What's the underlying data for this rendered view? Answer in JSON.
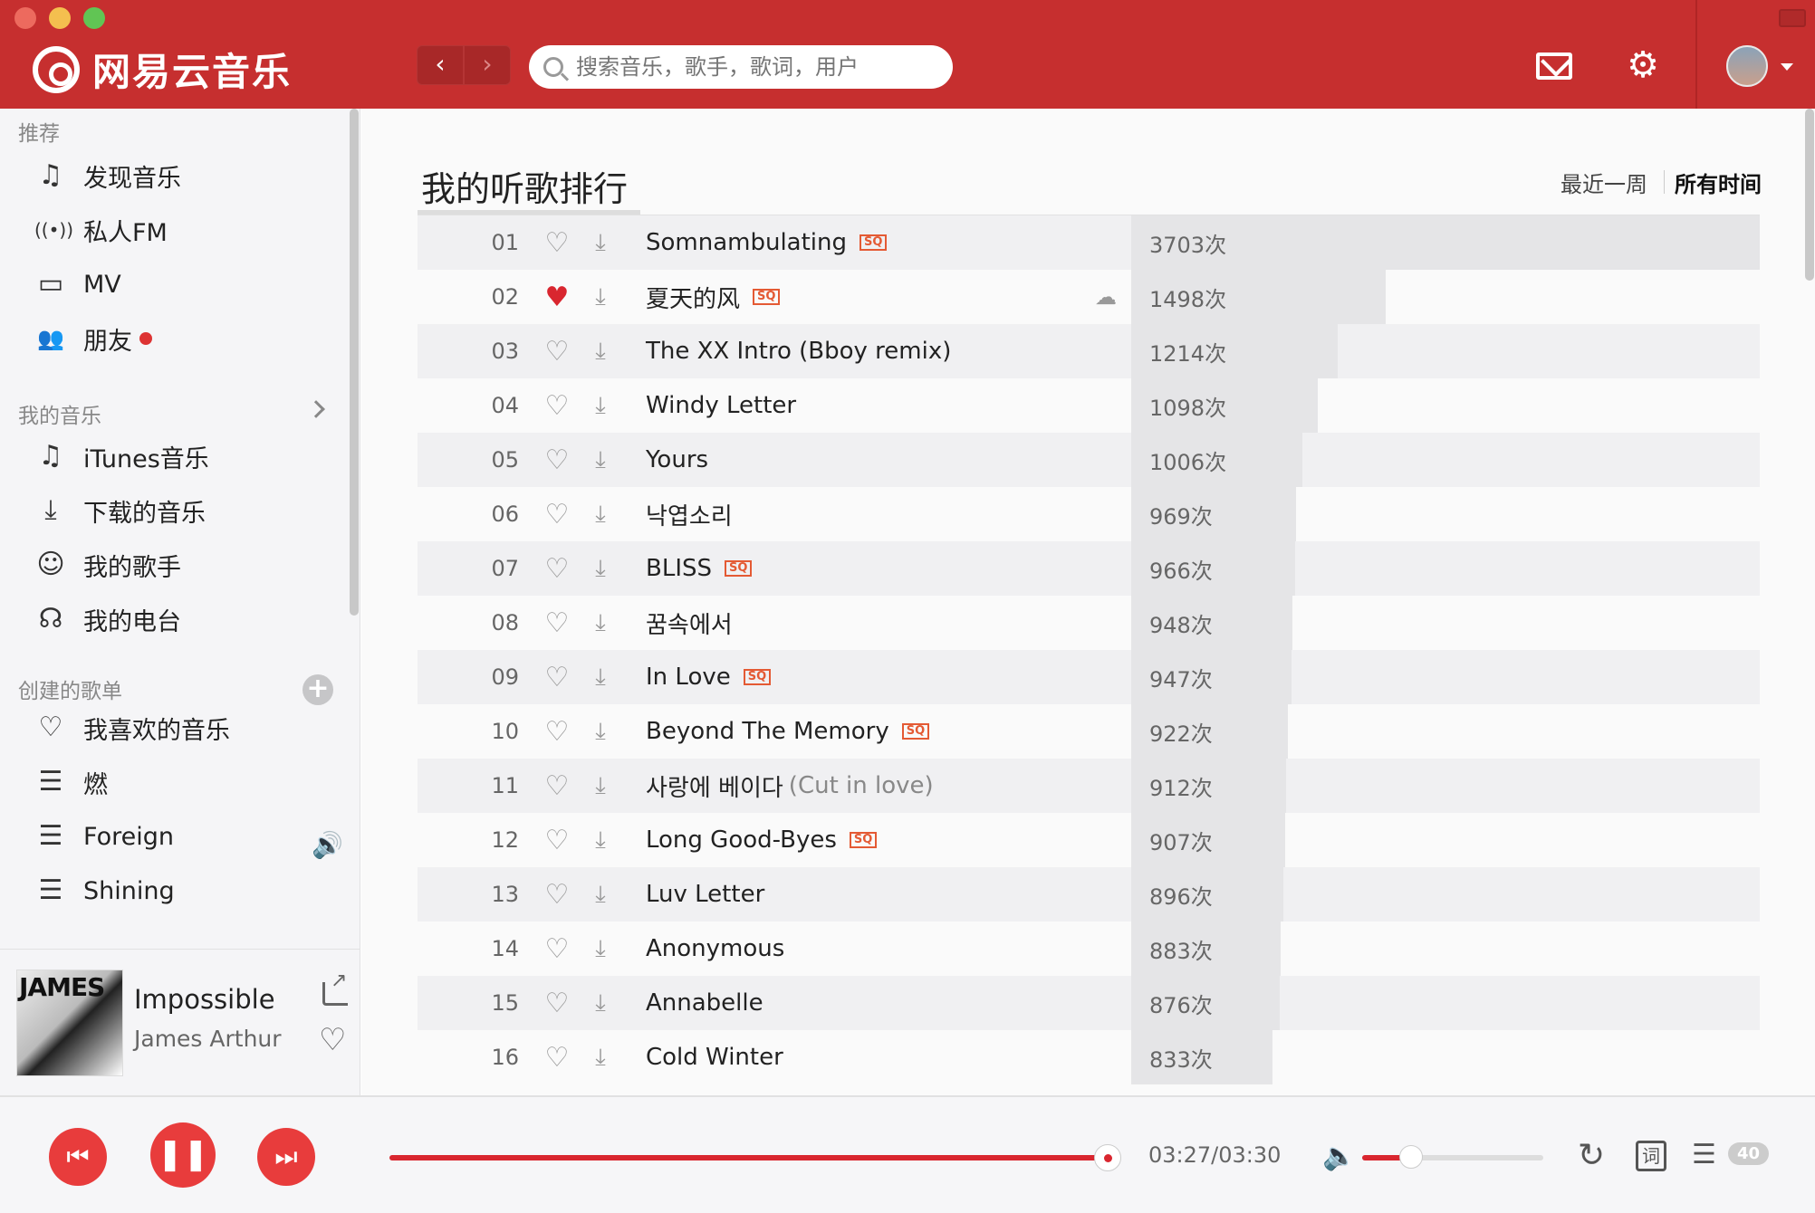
{
  "app": {
    "logo_text": "网易云音乐"
  },
  "header": {
    "back": "‹",
    "forward": "›",
    "search_placeholder": "搜索音乐，歌手，歌词，用户"
  },
  "sidebar": {
    "sec_recommend": "推荐",
    "recommend": [
      {
        "icon": "music-note-icon",
        "glyph": "♫",
        "label": "发现音乐"
      },
      {
        "icon": "radio-icon",
        "glyph": "((•))",
        "label": "私人FM"
      },
      {
        "icon": "tv-icon",
        "glyph": "▭",
        "label": "MV"
      },
      {
        "icon": "friends-icon",
        "glyph": "👥",
        "label": "朋友"
      }
    ],
    "sec_my_music": "我的音乐",
    "my_music": [
      {
        "icon": "itunes-icon",
        "glyph": "♫",
        "label": "iTunes音乐"
      },
      {
        "icon": "download-icon",
        "glyph": "⤓",
        "label": "下载的音乐"
      },
      {
        "icon": "person-icon",
        "glyph": "☺",
        "label": "我的歌手"
      },
      {
        "icon": "podcast-icon",
        "glyph": "☊",
        "label": "我的电台"
      }
    ],
    "sec_created": "创建的歌单",
    "created": [
      {
        "icon": "heart-icon",
        "glyph": "♡",
        "label": "我喜欢的音乐"
      },
      {
        "icon": "playlist-icon",
        "glyph": "☰",
        "label": "燃"
      },
      {
        "icon": "playlist-icon",
        "glyph": "☰",
        "label": "Foreign"
      },
      {
        "icon": "playlist-icon",
        "glyph": "☰",
        "label": "Shining"
      }
    ],
    "now_playing": {
      "cover_text": "JAMES",
      "title": "Impossible",
      "artist": "James Arthur"
    }
  },
  "main": {
    "title": "我的听歌排行",
    "filter_recent": "最近一周",
    "filter_all": "所有时间",
    "songs": [
      {
        "rank": "01",
        "name": "Somnambulating",
        "sub": "",
        "sq": true,
        "liked": false,
        "cloud": false,
        "plays": 3703,
        "count": "3703次"
      },
      {
        "rank": "02",
        "name": "夏天的风",
        "sub": "",
        "sq": true,
        "liked": true,
        "cloud": true,
        "plays": 1498,
        "count": "1498次"
      },
      {
        "rank": "03",
        "name": "The XX Intro (Bboy remix)",
        "sub": "",
        "sq": false,
        "liked": false,
        "cloud": false,
        "plays": 1214,
        "count": "1214次"
      },
      {
        "rank": "04",
        "name": "Windy Letter",
        "sub": "",
        "sq": false,
        "liked": false,
        "cloud": false,
        "plays": 1098,
        "count": "1098次"
      },
      {
        "rank": "05",
        "name": "Yours",
        "sub": "",
        "sq": false,
        "liked": false,
        "cloud": false,
        "plays": 1006,
        "count": "1006次"
      },
      {
        "rank": "06",
        "name": "낙엽소리",
        "sub": "",
        "sq": false,
        "liked": false,
        "cloud": false,
        "plays": 969,
        "count": "969次"
      },
      {
        "rank": "07",
        "name": "BLISS",
        "sub": "",
        "sq": true,
        "liked": false,
        "cloud": false,
        "plays": 966,
        "count": "966次"
      },
      {
        "rank": "08",
        "name": "꿈속에서",
        "sub": "",
        "sq": false,
        "liked": false,
        "cloud": false,
        "plays": 948,
        "count": "948次"
      },
      {
        "rank": "09",
        "name": "In Love",
        "sub": "",
        "sq": true,
        "liked": false,
        "cloud": false,
        "plays": 947,
        "count": "947次"
      },
      {
        "rank": "10",
        "name": "Beyond The Memory",
        "sub": "",
        "sq": true,
        "liked": false,
        "cloud": false,
        "plays": 922,
        "count": "922次"
      },
      {
        "rank": "11",
        "name": "사랑에 베이다",
        "sub": "(Cut in love)",
        "sq": false,
        "liked": false,
        "cloud": false,
        "plays": 912,
        "count": "912次"
      },
      {
        "rank": "12",
        "name": "Long Good-Byes",
        "sub": "",
        "sq": true,
        "liked": false,
        "cloud": false,
        "plays": 907,
        "count": "907次"
      },
      {
        "rank": "13",
        "name": "Luv Letter",
        "sub": "",
        "sq": false,
        "liked": false,
        "cloud": false,
        "plays": 896,
        "count": "896次"
      },
      {
        "rank": "14",
        "name": "Anonymous",
        "sub": "",
        "sq": false,
        "liked": false,
        "cloud": false,
        "plays": 883,
        "count": "883次"
      },
      {
        "rank": "15",
        "name": "Annabelle",
        "sub": "",
        "sq": false,
        "liked": false,
        "cloud": false,
        "plays": 876,
        "count": "876次"
      },
      {
        "rank": "16",
        "name": "Cold Winter",
        "sub": "",
        "sq": false,
        "liked": false,
        "cloud": false,
        "plays": 833,
        "count": "833次"
      }
    ],
    "sq_label": "SQ"
  },
  "player": {
    "time": "03:27/03:30",
    "progress": 0.986,
    "volume": 0.27,
    "playlist_count": "40",
    "lyric_glyph": "词"
  },
  "colors": {
    "brand_red": "#c62f2f",
    "accent_red": "#d9262f",
    "sq_orange": "#e45a34"
  }
}
